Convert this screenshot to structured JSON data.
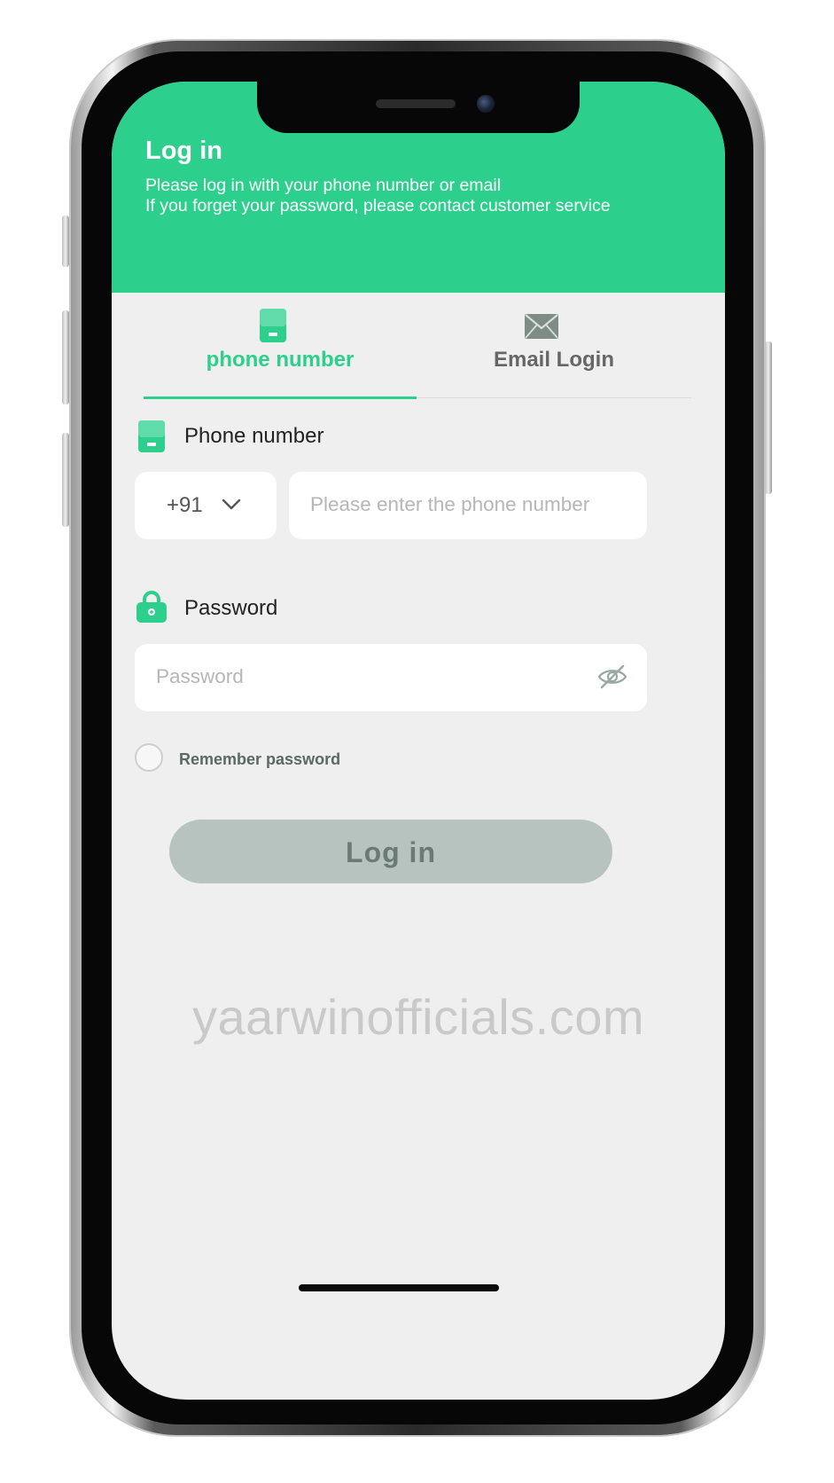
{
  "header": {
    "title": "Log in",
    "subtitle_line1": "Please log in with your phone number or email",
    "subtitle_line2": "If you forget your password, please contact customer service"
  },
  "tabs": [
    {
      "label": "phone number",
      "icon": "phone-icon",
      "active": true
    },
    {
      "label": "Email Login",
      "icon": "envelope-icon",
      "active": false
    }
  ],
  "phone_field": {
    "label": "Phone number",
    "country_code": "+91",
    "placeholder": "Please enter the phone number"
  },
  "password_field": {
    "label": "Password",
    "placeholder": "Password"
  },
  "remember": {
    "label": "Remember password",
    "checked": false
  },
  "login_button": {
    "label": "Log in"
  },
  "watermark": "yaarwinofficials.com",
  "colors": {
    "accent": "#2ccf8b",
    "button_disabled": "#b6c3be",
    "background": "#efefef"
  }
}
